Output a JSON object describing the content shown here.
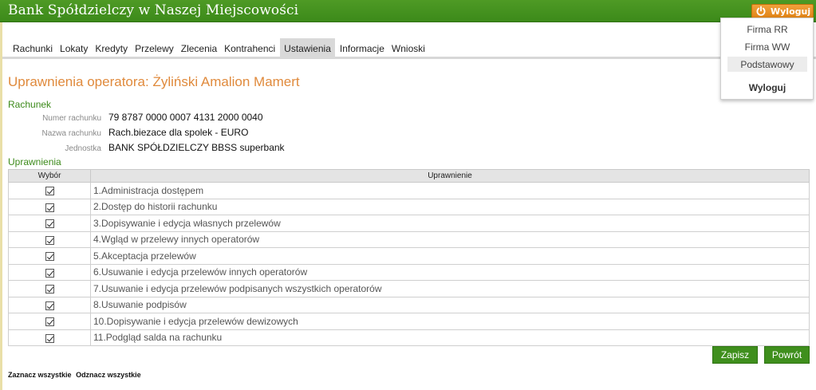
{
  "header": {
    "bank_name": "Bank Spółdzielczy w Naszej Miejscowości",
    "logout_label": "Wyloguj",
    "logout_icon": "power-icon",
    "brand_color": "#3c8a1a",
    "accent_color": "#e08416"
  },
  "nav": {
    "items": [
      "Rachunki",
      "Lokaty",
      "Kredyty",
      "Przelewy",
      "Zlecenia",
      "Kontrahenci",
      "Ustawienia",
      "Informacje",
      "Wnioski"
    ],
    "active": "Ustawienia"
  },
  "dropdown": {
    "items": [
      "Firma RR",
      "Firma WW",
      "Podstawowy"
    ],
    "highlighted": "Podstawowy",
    "logout": "Wyloguj"
  },
  "page": {
    "title": "Uprawnienia operatora: Żyliński Amalion Mamert",
    "account_section": "Rachunek",
    "account_number_label": "Numer rachunku",
    "account_number": "79 8787 0000 0007 4131 2000 0040",
    "account_name_label": "Nazwa rachunku",
    "account_name": "Rach.biezace dla spolek - EURO",
    "unit_label": "Jednostka",
    "unit": "BANK SPÓŁDZIELCZY BBSS superbank",
    "permissions_section": "Uprawnienia"
  },
  "table": {
    "col_select": "Wybór",
    "col_permission": "Uprawnienie",
    "rows": [
      {
        "checked": true,
        "label": "1.Administracja dostępem"
      },
      {
        "checked": true,
        "label": "2.Dostęp do historii rachunku"
      },
      {
        "checked": true,
        "label": "3.Dopisywanie i edycja własnych przelewów"
      },
      {
        "checked": true,
        "label": "4.Wgląd w przelewy innych operatorów"
      },
      {
        "checked": true,
        "label": "5.Akceptacja przelewów"
      },
      {
        "checked": true,
        "label": "6.Usuwanie i edycja przelewów innych operatorów"
      },
      {
        "checked": true,
        "label": "7.Usuwanie i edycja przelewów podpisanych wszystkich operatorów"
      },
      {
        "checked": true,
        "label": "8.Usuwanie podpisów"
      },
      {
        "checked": true,
        "label": "10.Dopisywanie i edycja przelewów dewizowych"
      },
      {
        "checked": true,
        "label": "11.Podgląd salda na rachunku"
      }
    ]
  },
  "actions": {
    "save": "Zapisz",
    "back": "Powrót",
    "select_all": "Zaznacz wszystkie",
    "deselect_all": "Odznacz wszystkie"
  }
}
